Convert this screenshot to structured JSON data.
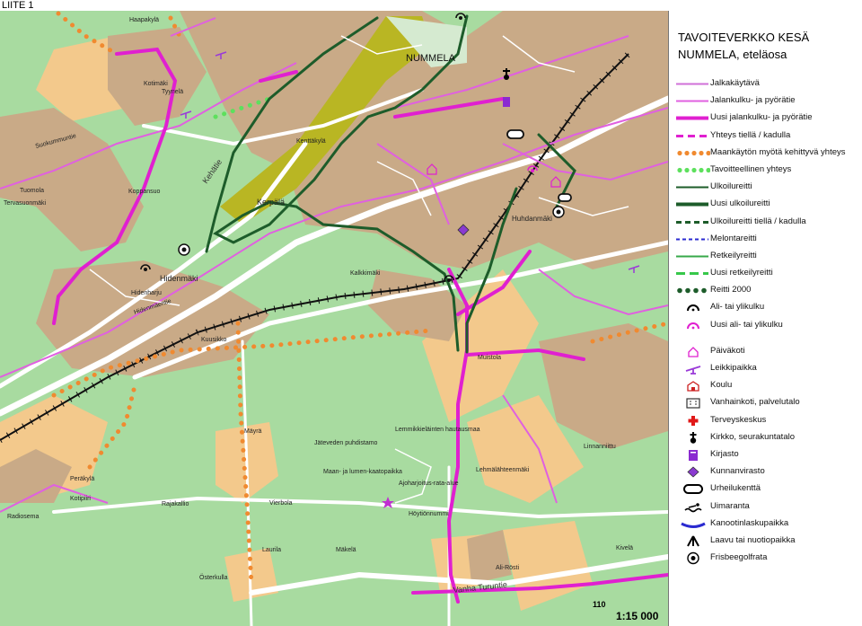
{
  "page_label": "LIITE 1",
  "map": {
    "scale": "1:15 000",
    "grid_number": "110",
    "place_names": {
      "haapakyla": "Haapakylä",
      "kotimaki": "Kotimäki",
      "tyynela": "Tyynelä",
      "suokummuntie": "Suokummuntie",
      "tuomola": "Tuomola",
      "tervasuonmaki": "Tervasuonmäki",
      "koppansuo": "Koppansuo",
      "kehatie": "Kehätie",
      "nummela": "NUMMELA",
      "kenttakyla": "Kenttäkylä",
      "kerpala": "Kerpälä",
      "hidenmaki": "Hidenmäki",
      "hidenharju": "Hidenharju",
      "hidenmaentie": "Hidenmäentie",
      "kalkkimaki": "Kalkkimäki",
      "kuusikko": "Kuusikko",
      "huhdanmaki": "Huhdanmäki",
      "muistola": "Muistola",
      "mayra": "Mäyrä",
      "jatevesi": "Jäteveden puhdistamo",
      "lemmikki": "Lemmikkieläinten hautausmaa",
      "maan_lumen": "Maan- ja lumen-kaatopaikka",
      "ajoharjoitus": "Ajoharjoitus-rata-alue",
      "lehmalahteenmaki": "Lehmälähteenmäki",
      "linnanniittu": "Linnanniittu",
      "perakyla": "Peräkylä",
      "kotipiiri": "Kotipiiri",
      "rajakallio": "Rajakallio",
      "vierbola": "Vierbola",
      "hoytionnummi": "Höytiönnummi",
      "radiosema": "Radiosema",
      "laurila": "Laurila",
      "makela": "Mäkelä",
      "osterkulla": "Österkulla",
      "ali_rosti": "Ali-Rösti",
      "kivela": "Kivelä",
      "vanha_turuntie": "Vanha Turuntie"
    }
  },
  "legend": {
    "title_line1": "TAVOITEVERKKO KESÄ",
    "title_line2": "NUMMELA, eteläosa",
    "items": [
      {
        "key": "jalkakaytava",
        "label": "Jalkakäytävä",
        "symbol": "line",
        "color": "#d070d8",
        "width": 2,
        "dash": ""
      },
      {
        "key": "jkpp",
        "label": "Jalankulku- ja pyörätie",
        "symbol": "line",
        "color": "#e060e0",
        "width": 2,
        "dash": ""
      },
      {
        "key": "uusi_jkpp",
        "label": "Uusi jalankulku- ja pyörätie",
        "symbol": "line",
        "color": "#e020d0",
        "width": 4,
        "dash": ""
      },
      {
        "key": "yhteys_kadulla",
        "label": "Yhteys tiellä / kadulla",
        "symbol": "line",
        "color": "#e020d0",
        "width": 3,
        "dash": "8,5"
      },
      {
        "key": "maankayton",
        "label": "Maankäytön myötä kehittyvä yhteys",
        "symbol": "dots",
        "color": "#f08a30"
      },
      {
        "key": "tavoitteellinen",
        "label": "Tavoitteellinen yhteys",
        "symbol": "dots",
        "color": "#5de05d"
      },
      {
        "key": "ulkoilureitti",
        "label": "Ulkoilureitti",
        "symbol": "line",
        "color": "#1d5c2a",
        "width": 2,
        "dash": ""
      },
      {
        "key": "uusi_ulkoilureitti",
        "label": "Uusi ulkoilureitti",
        "symbol": "line",
        "color": "#1d5c2a",
        "width": 4,
        "dash": ""
      },
      {
        "key": "ulkoilureitti_kadulla",
        "label": "Ulkoilureitti tiellä / kadulla",
        "symbol": "line",
        "color": "#1d5c2a",
        "width": 3,
        "dash": "6,4"
      },
      {
        "key": "melontareitti",
        "label": "Melontareitti",
        "symbol": "line",
        "color": "#2a2ad0",
        "width": 2,
        "dash": "4,3"
      },
      {
        "key": "retkeilyreitti",
        "label": "Retkeilyreitti",
        "symbol": "line",
        "color": "#37a84a",
        "width": 2,
        "dash": ""
      },
      {
        "key": "uusi_retkeilyreitti",
        "label": "Uusi retkeilyreitti",
        "symbol": "line",
        "color": "#37c84a",
        "width": 3,
        "dash": "10,5"
      },
      {
        "key": "reitti2000",
        "label": "Reitti 2000",
        "symbol": "bigdots",
        "color": "#1d5c2a"
      },
      {
        "key": "ali_ylikulku",
        "label": "Ali- tai ylikulku",
        "symbol": "arc",
        "color": "#000000"
      },
      {
        "key": "uusi_ali_ylikulku",
        "label": "Uusi ali- tai ylikulku",
        "symbol": "arc",
        "color": "#e020d0"
      },
      {
        "key": "gap1",
        "label": "",
        "symbol": "gap"
      },
      {
        "key": "paivakoti",
        "label": "Päiväkoti",
        "symbol": "house",
        "color": "#e020d0"
      },
      {
        "key": "leikkipaikka",
        "label": "Leikkipaikka",
        "symbol": "seesaw",
        "color": "#9a3ad8"
      },
      {
        "key": "koulu",
        "label": "Koulu",
        "symbol": "school",
        "color": "#cc2020"
      },
      {
        "key": "vanhainkoti",
        "label": "Vanhainkoti, palvelutalo",
        "symbol": "building",
        "color": "#333333"
      },
      {
        "key": "terveyskeskus",
        "label": "Terveyskeskus",
        "symbol": "cross",
        "color": "#e01818"
      },
      {
        "key": "kirkko",
        "label": "Kirkko, seurakuntatalo",
        "symbol": "church",
        "color": "#000000"
      },
      {
        "key": "kirjasto",
        "label": "Kirjasto",
        "symbol": "book",
        "color": "#8a2ad0"
      },
      {
        "key": "kunnanvirasto",
        "label": "Kunnanvirasto",
        "symbol": "diamond",
        "color": "#8a3ad0"
      },
      {
        "key": "urheilukentta",
        "label": "Urheilukenttä",
        "symbol": "track",
        "color": "#000000"
      },
      {
        "key": "uimaranta",
        "label": "Uimaranta",
        "symbol": "swim",
        "color": "#000000"
      },
      {
        "key": "kanootti",
        "label": "Kanootinlaskupaikka",
        "symbol": "canoe",
        "color": "#2a2ad0"
      },
      {
        "key": "laavu",
        "label": "Laavu tai nuotiopaikka",
        "symbol": "tent",
        "color": "#000000"
      },
      {
        "key": "frisbee",
        "label": "Frisbeegolfrata",
        "symbol": "frisbee",
        "color": "#000000"
      }
    ]
  }
}
